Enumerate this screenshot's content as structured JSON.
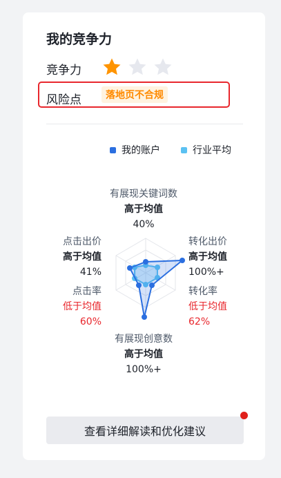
{
  "title": "我的竞争力",
  "competitiveness": {
    "label": "竞争力",
    "rating": 1,
    "max": 3
  },
  "risk": {
    "label": "风险点",
    "tag": "落地页不合规"
  },
  "legend": [
    {
      "name": "我的账户",
      "color": "#2b6fe0"
    },
    {
      "name": "行业平均",
      "color": "#5bc1f2"
    }
  ],
  "metrics": {
    "top": {
      "name": "有展现关键词数",
      "status": "高于均值",
      "value": "40%"
    },
    "right1": {
      "name": "转化出价",
      "status": "高于均值",
      "value": "100%+"
    },
    "right2": {
      "name": "转化率",
      "status": "低于均值",
      "value": "62%"
    },
    "bottom": {
      "name": "有展现创意数",
      "status": "高于均值",
      "value": "100%+"
    },
    "left2": {
      "name": "点击率",
      "status": "低于均值",
      "value": "60%"
    },
    "left1": {
      "name": "点击出价",
      "status": "高于均值",
      "value": "41%"
    }
  },
  "cta": {
    "label": "查看详细解读和优化建议"
  }
}
